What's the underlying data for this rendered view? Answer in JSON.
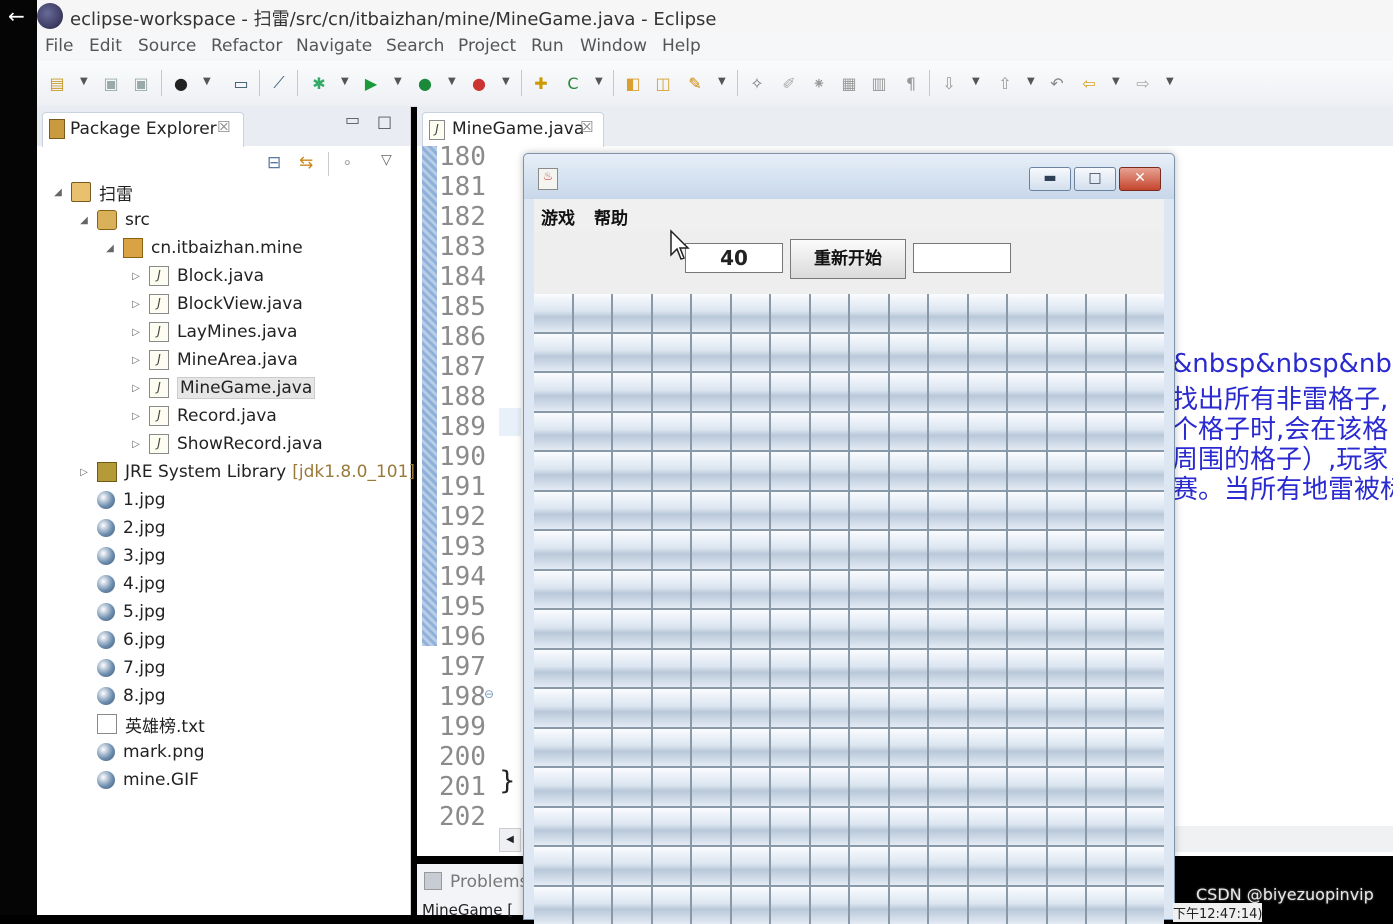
{
  "window": {
    "title": "eclipse-workspace - 扫雷/src/cn/itbaizhan/mine/MineGame.java - Eclipse"
  },
  "menubar": [
    "File",
    "Edit",
    "Source",
    "Refactor",
    "Navigate",
    "Search",
    "Project",
    "Run",
    "Window",
    "Help"
  ],
  "package_explorer": {
    "tab_label": "Package Explorer",
    "tree": [
      {
        "label": "扫雷",
        "icon": "project-icon",
        "twisty": "◢",
        "indent": 0
      },
      {
        "label": "src",
        "icon": "source-folder-icon",
        "twisty": "◢",
        "indent": 1
      },
      {
        "label": "cn.itbaizhan.mine",
        "icon": "package-icon",
        "twisty": "◢",
        "indent": 2
      },
      {
        "label": "Block.java",
        "icon": "java-file-icon",
        "twisty": "▷",
        "indent": 3
      },
      {
        "label": "BlockView.java",
        "icon": "java-file-icon",
        "twisty": "▷",
        "indent": 3
      },
      {
        "label": "LayMines.java",
        "icon": "java-file-icon",
        "twisty": "▷",
        "indent": 3
      },
      {
        "label": "MineArea.java",
        "icon": "java-file-icon",
        "twisty": "▷",
        "indent": 3
      },
      {
        "label": "MineGame.java",
        "icon": "java-file-icon",
        "twisty": "▷",
        "indent": 3,
        "selected": true
      },
      {
        "label": "Record.java",
        "icon": "java-file-icon",
        "twisty": "▷",
        "indent": 3
      },
      {
        "label": "ShowRecord.java",
        "icon": "java-file-icon",
        "twisty": "▷",
        "indent": 3
      },
      {
        "label": "JRE System Library",
        "suffix": "[jdk1.8.0_101]",
        "icon": "library-icon",
        "twisty": "▷",
        "indent": 1
      },
      {
        "label": "1.jpg",
        "icon": "image-file-icon",
        "indent": 1
      },
      {
        "label": "2.jpg",
        "icon": "image-file-icon",
        "indent": 1
      },
      {
        "label": "3.jpg",
        "icon": "image-file-icon",
        "indent": 1
      },
      {
        "label": "4.jpg",
        "icon": "image-file-icon",
        "indent": 1
      },
      {
        "label": "5.jpg",
        "icon": "image-file-icon",
        "indent": 1
      },
      {
        "label": "6.jpg",
        "icon": "image-file-icon",
        "indent": 1
      },
      {
        "label": "7.jpg",
        "icon": "image-file-icon",
        "indent": 1
      },
      {
        "label": "8.jpg",
        "icon": "image-file-icon",
        "indent": 1
      },
      {
        "label": "英雄榜.txt",
        "icon": "text-file-icon",
        "indent": 1
      },
      {
        "label": "mark.png",
        "icon": "image-file-icon",
        "indent": 1
      },
      {
        "label": "mine.GIF",
        "icon": "image-file-icon",
        "indent": 1
      }
    ]
  },
  "editor": {
    "tab_label": "MineGame.java",
    "line_numbers": [
      "180",
      "181",
      "182",
      "183",
      "184",
      "185",
      "186",
      "187",
      "188",
      "189",
      "190",
      "191",
      "192",
      "193",
      "194",
      "195",
      "196",
      "197",
      "198",
      "199",
      "200",
      "201",
      "202"
    ],
    "closing_brace": "}",
    "visible_code_fragments": [
      "&nbsp&nbsp&nbsp",
      "找出所有非雷格子,",
      "个格子时,会在该格",
      "周围的格子）,玩家",
      "赛。当所有地雷被标"
    ]
  },
  "bottom_panel": {
    "tab_label": "Problems",
    "row_text": "MineGame ["
  },
  "dialog": {
    "menus": [
      "游戏",
      "帮助"
    ],
    "mine_count": "40",
    "restart_label": "重新开始",
    "timer_value": "",
    "grid_rows": 16,
    "grid_cols": 16
  },
  "watermark": "CSDN @biyezuopinvip",
  "clock": "下午12:47:14)"
}
